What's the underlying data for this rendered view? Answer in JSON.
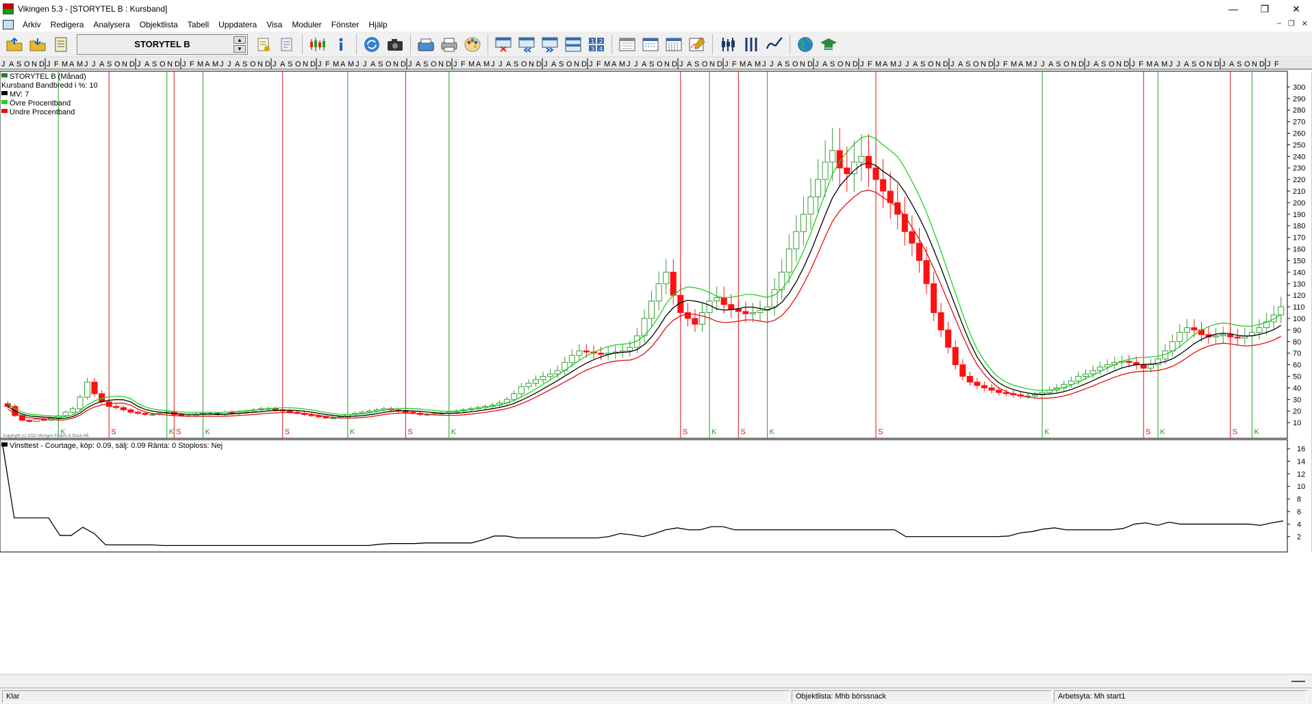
{
  "window": {
    "title": "Vikingen 5.3 - [STORYTEL B : Kursband]"
  },
  "menu": [
    "Arkiv",
    "Redigera",
    "Analysera",
    "Objektlista",
    "Tabell",
    "Uppdatera",
    "Visa",
    "Moduler",
    "Fönster",
    "Hjälp"
  ],
  "toolbar": {
    "ticker": "STORYTEL B"
  },
  "legend": {
    "series_name": "STORYTEL B (Månad)",
    "band_label": "Kursband  Bandbredd i %: 10",
    "mv_label": "MV: 7",
    "upper_label": "Övre Procentband",
    "lower_label": "Undre Procentband"
  },
  "lower_panel_label": "Vinsttest - Courtage, köp: 0.09, sälj: 0.09  Ränta: 0  Stoploss: Nej",
  "copyright": "Copyright (c) 2022 Vikingen Finans & Stock AB",
  "status": {
    "ready": "Klar",
    "objektlista": "Objektlista: Mhb börssnack",
    "arbetsyta": "Arbetsyta: Mh start1"
  },
  "colors": {
    "up": "#3a9b3a",
    "down": "#ff1010",
    "buy_line": "#20a020",
    "sell_line": "#e01010",
    "mv": "#000000",
    "upper": "#20d020",
    "lower": "#e01010"
  },
  "chart_data": [
    {
      "type": "candlestick",
      "title": "STORYTEL B (Månad)",
      "ylim": [
        0,
        310
      ],
      "y_ticks": [
        10,
        20,
        30,
        40,
        50,
        60,
        70,
        80,
        90,
        100,
        110,
        120,
        130,
        140,
        150,
        160,
        170,
        180,
        190,
        200,
        210,
        220,
        230,
        240,
        250,
        260,
        270,
        280,
        290,
        300
      ],
      "x_month_letters": [
        "J",
        "A",
        "S",
        "O",
        "N",
        "D",
        "J",
        "F",
        "M",
        "A",
        "M",
        "J",
        "J",
        "A",
        "S",
        "O",
        "N",
        "D"
      ],
      "close": [
        24,
        16,
        12,
        11,
        13,
        12,
        14,
        16,
        19,
        22,
        32,
        45,
        35,
        28,
        24,
        23,
        21,
        19,
        18,
        17,
        17,
        18,
        19,
        17,
        16,
        16,
        17,
        18,
        18,
        17,
        19,
        18,
        19,
        20,
        21,
        22,
        22,
        21,
        20,
        19,
        18,
        17,
        16,
        15,
        14,
        14,
        15,
        17,
        18,
        19,
        20,
        21,
        22,
        21,
        20,
        19,
        18,
        17,
        17,
        18,
        18,
        19,
        20,
        21,
        22,
        23,
        24,
        25,
        27,
        30,
        35,
        41,
        44,
        47,
        50,
        52,
        55,
        62,
        68,
        72,
        71,
        70,
        69,
        70,
        71,
        72,
        75,
        85,
        100,
        115,
        130,
        140,
        120,
        105,
        100,
        95,
        105,
        115,
        118,
        112,
        108,
        106,
        104,
        105,
        107,
        110,
        125,
        140,
        160,
        175,
        190,
        205,
        220,
        235,
        245,
        230,
        225,
        235,
        240,
        230,
        220,
        210,
        200,
        190,
        175,
        165,
        150,
        130,
        105,
        90,
        75,
        60,
        50,
        45,
        42,
        40,
        38,
        36,
        35,
        34,
        33,
        33,
        34,
        36,
        38,
        40,
        43,
        46,
        50,
        52,
        55,
        58,
        60,
        62,
        63,
        62,
        60,
        57,
        60,
        65,
        72,
        80,
        88,
        92,
        90,
        86,
        84,
        85,
        86,
        84,
        83,
        85,
        88,
        92,
        97,
        103,
        110
      ]
    },
    {
      "type": "line",
      "title": "Vinsttest - Courtage, köp: 0.09, sälj: 0.09  Ränta: 0  Stoploss: Nej",
      "ylim": [
        0,
        17
      ],
      "y_ticks": [
        2,
        4,
        6,
        8,
        10,
        12,
        14,
        16
      ],
      "values": [
        16.5,
        5,
        5,
        5,
        5,
        2.2,
        2.2,
        3.5,
        2.5,
        0.7,
        0.7,
        0.7,
        0.7,
        0.7,
        0.6,
        0.6,
        0.6,
        0.6,
        0.6,
        0.6,
        0.6,
        0.6,
        0.6,
        0.6,
        0.6,
        0.6,
        0.6,
        0.6,
        0.6,
        0.6,
        0.6,
        0.6,
        0.6,
        0.8,
        0.9,
        0.9,
        0.9,
        1.0,
        1.0,
        1.0,
        1.0,
        1.0,
        1.5,
        2.1,
        2.1,
        1.8,
        1.8,
        1.8,
        1.8,
        1.8,
        1.8,
        1.8,
        1.8,
        2.0,
        2.5,
        2.3,
        2.0,
        2.5,
        3.1,
        3.4,
        3.1,
        3.1,
        3.6,
        3.6,
        3.1,
        3.1,
        3.1,
        3.1,
        3.1,
        3.1,
        3.1,
        3.1,
        3.1,
        3.1,
        3.1,
        3.1,
        3.1,
        3.1,
        3.1,
        2.0,
        2.0,
        2.0,
        2.0,
        2.0,
        2.0,
        2.0,
        2.0,
        2.0,
        2.1,
        2.6,
        2.8,
        3.2,
        3.4,
        3.1,
        3.1,
        3.1,
        3.1,
        3.1,
        3.3,
        4.0,
        4.2,
        3.8,
        4.3,
        4.0,
        4.0,
        4.0,
        4.0,
        4.0,
        4.0,
        4.0,
        3.8,
        4.2,
        4.5
      ]
    }
  ]
}
